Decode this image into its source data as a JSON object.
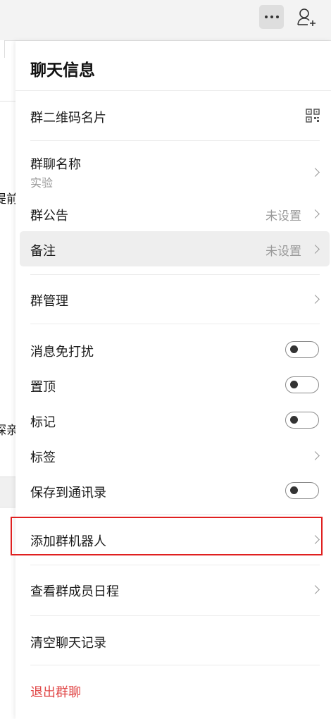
{
  "background_chat": {
    "fragment_1": "提前",
    "fragment_2": "探亲"
  },
  "panel": {
    "title": "聊天信息",
    "qr_label": "群二维码名片",
    "group_name_label": "群聊名称",
    "group_name_value": "实验",
    "announcement_label": "群公告",
    "announcement_value": "未设置",
    "remark_label": "备注",
    "remark_value": "未设置",
    "manage_label": "群管理",
    "mute_label": "消息免打扰",
    "mute_on": false,
    "pin_label": "置顶",
    "pin_on": false,
    "mark_label": "标记",
    "mark_on": false,
    "tags_label": "标签",
    "save_contacts_label": "保存到通讯录",
    "save_contacts_on": false,
    "add_bot_label": "添加群机器人",
    "member_schedule_label": "查看群成员日程",
    "clear_history_label": "清空聊天记录",
    "exit_label": "退出群聊"
  },
  "colors": {
    "danger": "#e04545",
    "highlight_border": "#e02020"
  },
  "icons": [
    "more-icon",
    "add-member-icon",
    "qr-code-icon",
    "chevron-right-icon"
  ]
}
